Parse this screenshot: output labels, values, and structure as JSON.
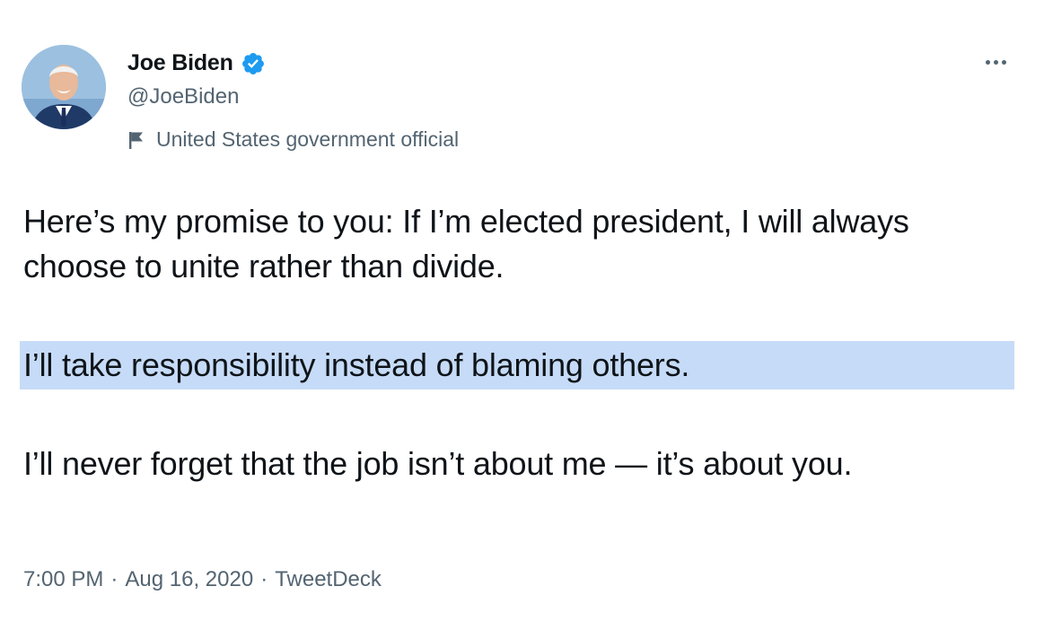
{
  "author": {
    "display_name": "Joe Biden",
    "handle": "@JoeBiden",
    "label": "United States government official",
    "verified_icon": "verified-badge-icon",
    "label_icon": "flag-icon"
  },
  "tweet": {
    "paragraph_1": "Here’s my promise to you: If I’m elected president, I will always choose to unite rather than divide.",
    "paragraph_2": "I’ll take responsibility instead of blaming others.",
    "paragraph_3": "I’ll never forget that the job isn’t about me — it’s about you.",
    "highlight_color": "#c6dbf7"
  },
  "meta": {
    "time": "7:00 PM",
    "separator": "·",
    "date": "Aug 16, 2020",
    "source": "TweetDeck"
  },
  "colors": {
    "verified_blue": "#1d9bf0",
    "secondary_text": "#536471",
    "primary_text": "#0f1419"
  }
}
